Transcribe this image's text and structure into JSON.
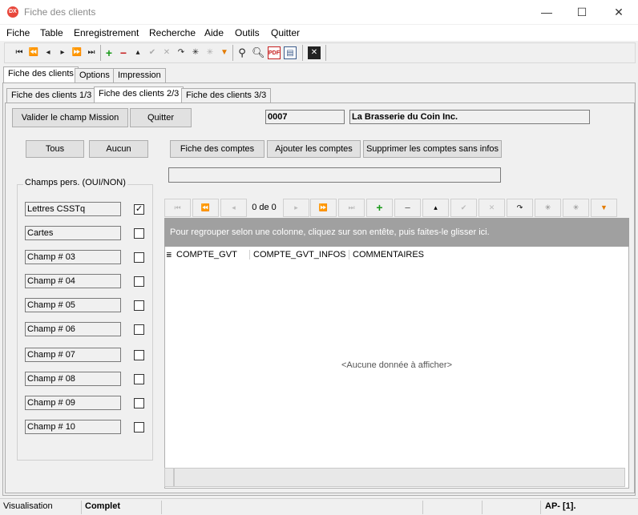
{
  "window": {
    "title": "Fiche des clients",
    "icon_text": "DX",
    "minimize": "—",
    "maximize": "☐",
    "close": "✕"
  },
  "menu": [
    "Fiche",
    "Table",
    "Enregistrement",
    "Recherche",
    "Aide",
    "Outils",
    "Quitter"
  ],
  "toolbar": {
    "buttons": [
      "first-icon",
      "prev-page-icon",
      "prev-icon",
      "next-icon",
      "next-page-icon",
      "last-icon",
      "add-icon",
      "delete-icon",
      "up-icon",
      "check-icon",
      "cancel-icon",
      "refresh-icon",
      "asterisk-icon",
      "asterisk-alt-icon",
      "filter-icon",
      "binoculars-icon",
      "search-icon",
      "pdf-mail-icon",
      "card-icon",
      "close-box-icon"
    ]
  },
  "tabs_main": [
    "Fiche des clients",
    "Options",
    "Impression"
  ],
  "tabs_sub": [
    "Fiche des clients 1/3",
    "Fiche des clients 2/3",
    "Fiche des clients 3/3"
  ],
  "buttons": {
    "valider": "Valider le champ Mission",
    "quitter": "Quitter",
    "tous": "Tous",
    "aucun": "Aucun",
    "fiche_comptes": "Fiche des comptes",
    "ajouter_comptes": "Ajouter les comptes",
    "supprimer_comptes": "Supprimer les comptes sans infos"
  },
  "record": {
    "id": "0007",
    "name": "La Brasserie du Coin Inc."
  },
  "custom_fields": {
    "group_label": "Champs pers. (OUI/NON)",
    "items": [
      {
        "label": "Lettres CSSTq",
        "checked": true
      },
      {
        "label": "Cartes",
        "checked": false
      },
      {
        "label": "Champ # 03",
        "checked": false
      },
      {
        "label": "Champ # 04",
        "checked": false
      },
      {
        "label": "Champ # 05",
        "checked": false
      },
      {
        "label": "Champ # 06",
        "checked": false
      },
      {
        "label": "Champ # 07",
        "checked": false
      },
      {
        "label": "Champ # 08",
        "checked": false
      },
      {
        "label": "Champ # 09",
        "checked": false
      },
      {
        "label": "Champ # 10",
        "checked": false
      }
    ]
  },
  "grid": {
    "nav_text": "0 de 0",
    "group_hint": "Pour regrouper selon une colonne, cliquez sur son entête, puis faites-le glisser ici.",
    "columns": [
      "COMPTE_GVT",
      "COMPTE_GVT_INFOS",
      "COMMENTAIRES"
    ],
    "empty_text": "<Aucune donnée à afficher>"
  },
  "status": {
    "mode": "Visualisation",
    "state": "Complet",
    "right": "AP- [1]."
  }
}
